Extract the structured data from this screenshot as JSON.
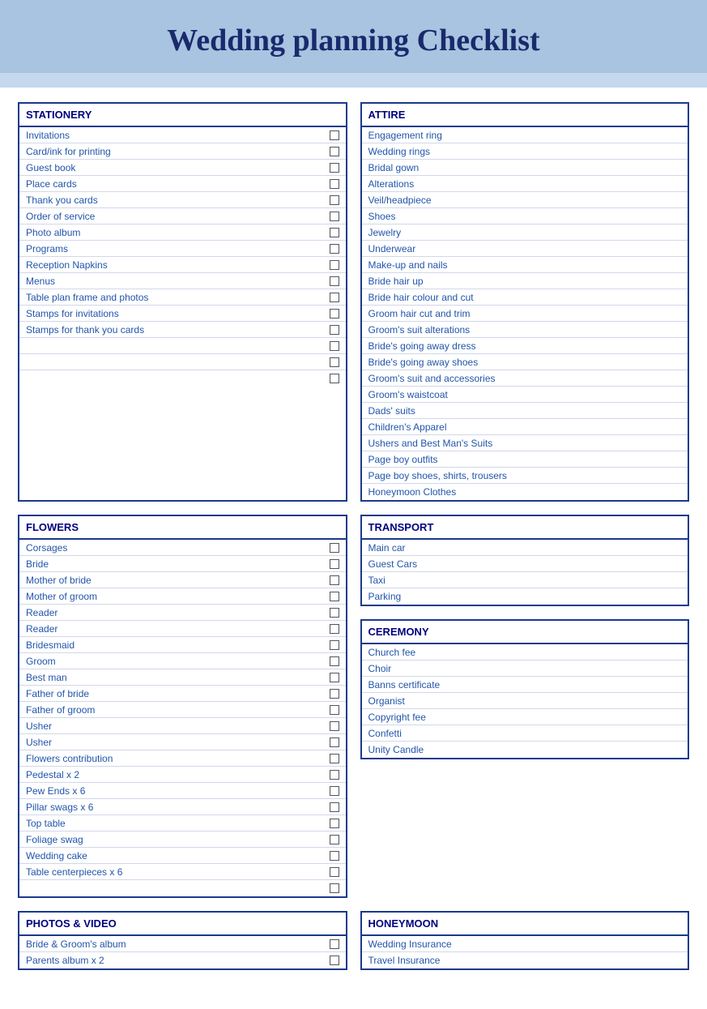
{
  "header": {
    "title": "Wedding planning Checklist"
  },
  "sections": {
    "stationery": {
      "title": "STATIONERY",
      "items": [
        "Invitations",
        "Card/ink for printing",
        "Guest book",
        "Place cards",
        "Thank you cards",
        "Order of service",
        "Photo album",
        "Programs",
        "Reception Napkins",
        "Menus",
        "Table plan frame and photos",
        "Stamps for invitations",
        "Stamps for thank you cards",
        "",
        "",
        ""
      ]
    },
    "attire": {
      "title": "ATTIRE",
      "items": [
        "Engagement ring",
        "Wedding rings",
        "Bridal gown",
        "Alterations",
        "Veil/headpiece",
        "Shoes",
        "Jewelry",
        "Underwear",
        "Make-up and nails",
        "Bride hair up",
        "Bride hair colour and cut",
        "Groom hair cut and trim",
        "Groom's suit alterations",
        "Bride's going away dress",
        "Bride's going away shoes",
        "Groom's suit and accessories",
        "Groom's waistcoat",
        "Dads' suits",
        "Children's Apparel",
        "Ushers and Best Man's Suits",
        "Page boy outfits",
        "Page boy shoes, shirts, trousers",
        "Honeymoon Clothes"
      ]
    },
    "flowers": {
      "title": "FLOWERS",
      "items": [
        "Corsages",
        "Bride",
        "Mother of bride",
        "Mother of groom",
        "Reader",
        "Reader",
        "Bridesmaid",
        "Groom",
        "Best man",
        "Father of bride",
        "Father of groom",
        "Usher",
        "Usher",
        "Flowers contribution",
        "Pedestal x 2",
        "Pew Ends x 6",
        "Pillar swags x 6",
        "Top table",
        "Foliage swag",
        "Wedding cake",
        "Table centerpieces x 6",
        ""
      ]
    },
    "transport": {
      "title": "TRANSPORT",
      "items": [
        "Main car",
        "Guest Cars",
        "Taxi",
        "Parking"
      ]
    },
    "ceremony": {
      "title": "CEREMONY",
      "items": [
        "Church fee",
        "Choir",
        "Banns certificate",
        "Organist",
        "Copyright fee",
        "Confetti",
        "Unity Candle"
      ]
    },
    "photos": {
      "title": "PHOTOS & VIDEO",
      "items": [
        "Bride & Groom's album",
        "Parents album x 2"
      ]
    },
    "honeymoon": {
      "title": "HONEYMOON",
      "items": [
        "Wedding Insurance",
        "Travel Insurance"
      ]
    }
  }
}
